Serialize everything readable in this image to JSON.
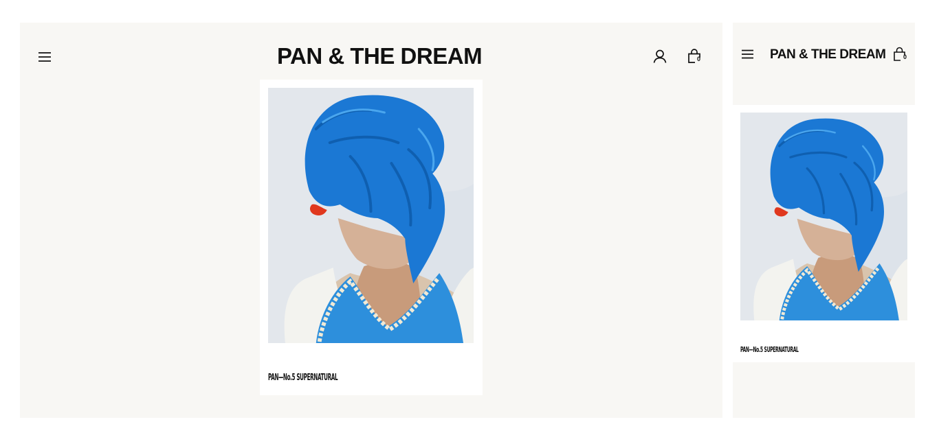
{
  "brand": {
    "logo_text": "PAN & THE DREAM"
  },
  "header": {
    "menu_icon": "hamburger-menu-icon",
    "account_icon": "user-account-icon",
    "cart_icon": "shopping-bag-icon",
    "cart_count": "0"
  },
  "product": {
    "title": "PAN—No.5  SUPERNATURAL",
    "cover_image": "magazine-cover-blue-hair-portrait"
  },
  "colors": {
    "panel_background": "#f8f7f4",
    "card_background": "#ffffff",
    "text": "#111111",
    "cover_hair_blue": "#1a73d0",
    "cover_lips_red": "#e0381e"
  }
}
